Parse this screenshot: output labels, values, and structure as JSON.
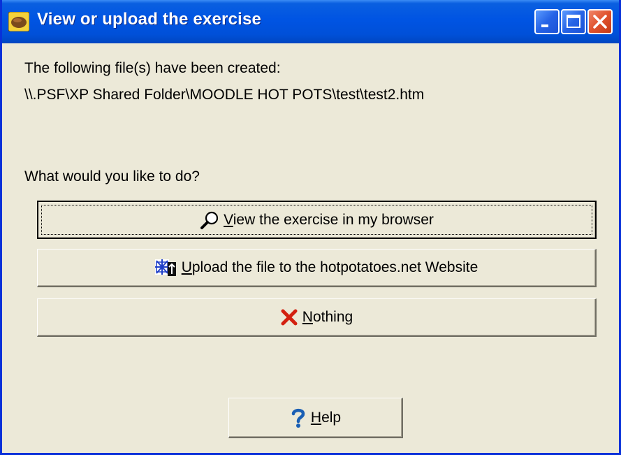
{
  "window": {
    "title": "View or upload the exercise"
  },
  "message": {
    "line1": "The following file(s) have been created:",
    "line2": "\\\\.PSF\\XP Shared Folder\\MOODLE HOT POTS\\test\\test2.htm",
    "question": "What would you like to do?"
  },
  "buttons": {
    "view": {
      "mnemonic": "V",
      "rest": "iew the exercise in my browser",
      "icon": "magnifier-icon"
    },
    "upload": {
      "mnemonic": "U",
      "rest": "pload the file to the hotpotatoes.net Website",
      "icon": "upload-web-icon"
    },
    "nothing": {
      "mnemonic": "N",
      "rest": "othing",
      "icon": "red-x-icon"
    },
    "help": {
      "mnemonic": "H",
      "rest": "elp",
      "icon": "question-mark-icon"
    }
  },
  "colors": {
    "titlebar": "#0054e3",
    "dialog_bg": "#ece9d8",
    "close_button": "#e0522d",
    "help_icon": "#1a5fb4",
    "nothing_icon": "#d32010"
  }
}
